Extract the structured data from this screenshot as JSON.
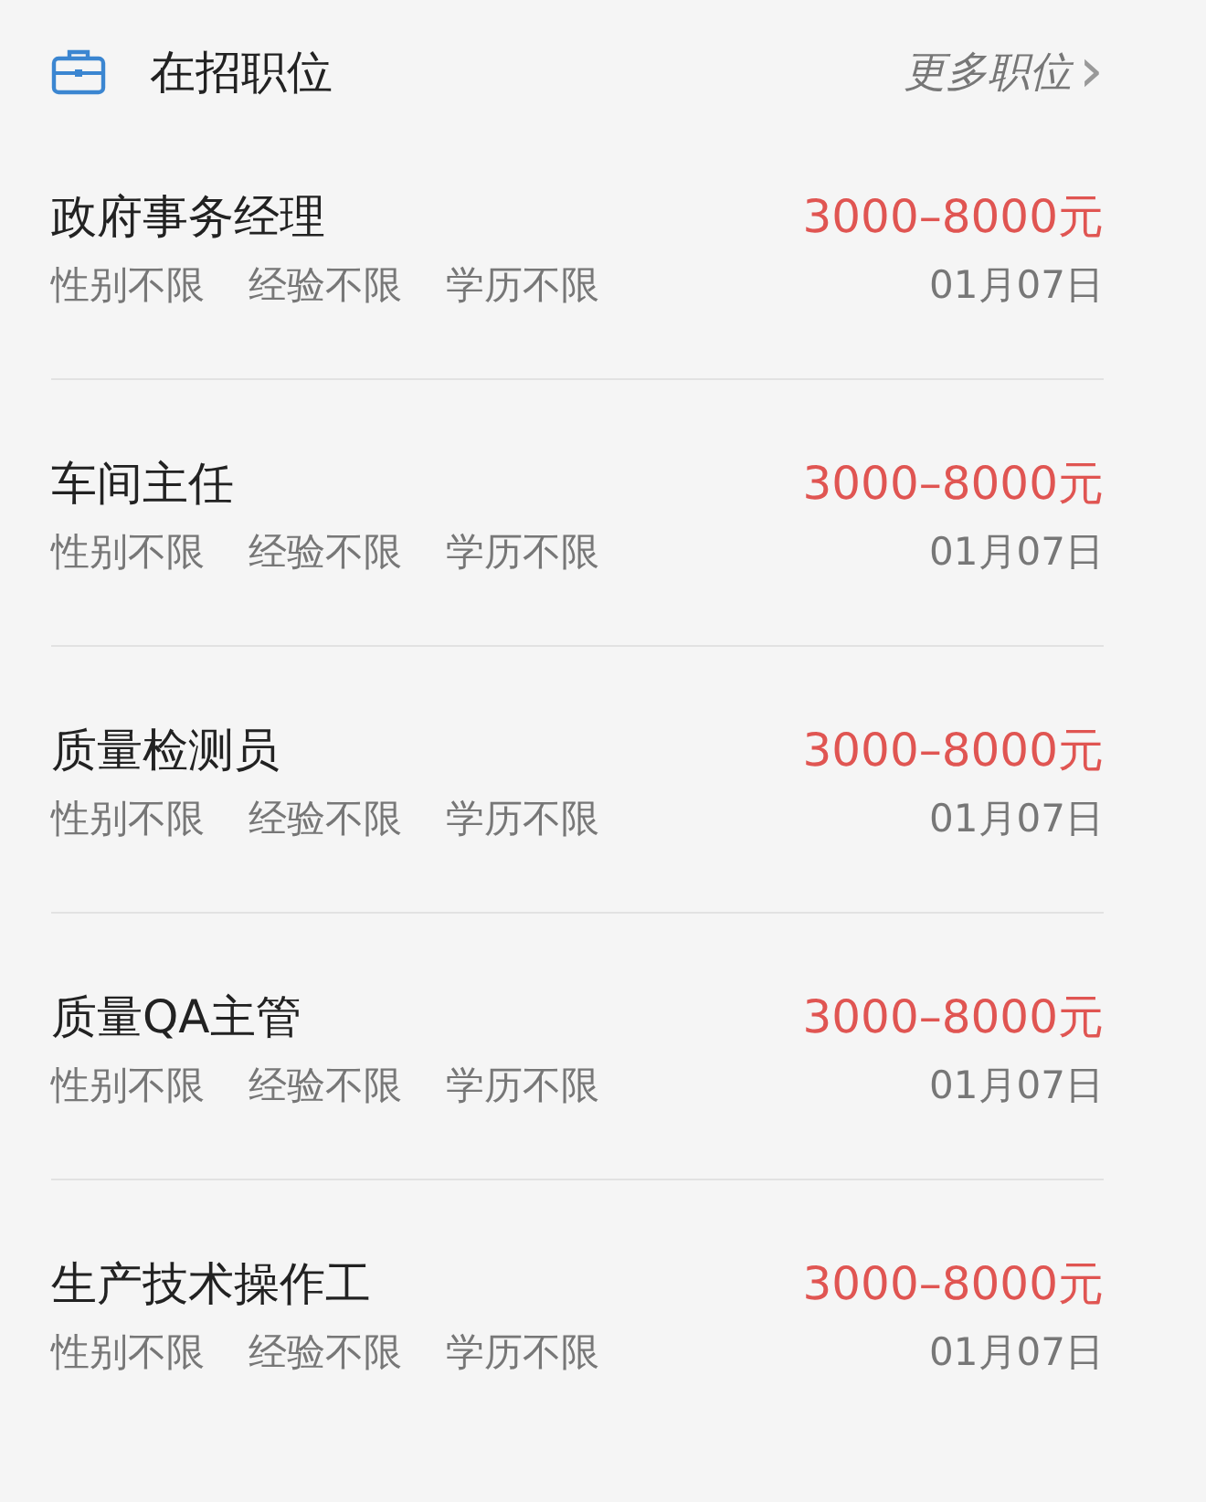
{
  "header": {
    "title": "在招职位",
    "more_link": "更多职位",
    "chevron": "›"
  },
  "jobs": [
    {
      "title": "政府事务经理",
      "salary": "3000–8000元",
      "tags": [
        "性别不限",
        "经验不限",
        "学历不限"
      ],
      "date": "01月07日"
    },
    {
      "title": "车间主任",
      "salary": "3000–8000元",
      "tags": [
        "性别不限",
        "经验不限",
        "学历不限"
      ],
      "date": "01月07日"
    },
    {
      "title": "质量检测员",
      "salary": "3000–8000元",
      "tags": [
        "性别不限",
        "经验不限",
        "学历不限"
      ],
      "date": "01月07日"
    },
    {
      "title": "质量QA主管",
      "salary": "3000–8000元",
      "tags": [
        "性别不限",
        "经验不限",
        "学历不限"
      ],
      "date": "01月07日"
    },
    {
      "title": "生产技术操作工",
      "salary": "3000–8000元",
      "tags": [
        "性别不限",
        "经验不限",
        "学历不限"
      ],
      "date": "01月07日"
    }
  ]
}
